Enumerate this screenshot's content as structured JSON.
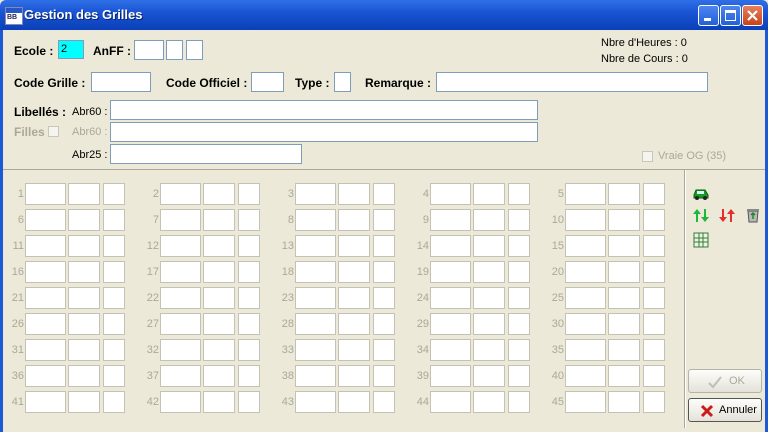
{
  "window": {
    "title": "Gestion des Grilles",
    "app_icon_text": "BB"
  },
  "header": {
    "ecole_label": "Ecole :",
    "ecole_value": "2",
    "anff_label": "AnFF :",
    "anff_values": [
      "",
      "",
      ""
    ],
    "nbre_heures": "Nbre d'Heures : 0",
    "nbre_cours": "Nbre de Cours : 0",
    "code_grille_label": "Code Grille :",
    "code_grille_value": "",
    "code_officiel_label": "Code Officiel :",
    "code_officiel_value": "",
    "type_label": "Type :",
    "type_value": "",
    "remarque_label": "Remarque :",
    "remarque_value": "",
    "libelles_label": "Libellés :",
    "abr60_label": "Abr60 :",
    "abr60_value": "",
    "filles_label": "Filles",
    "abr60_filles_label": "Abr60 :",
    "abr60_filles_value": "",
    "abr25_label": "Abr25 :",
    "abr25_value": "",
    "vraie_og_label": "Vraie OG (35)"
  },
  "grid": {
    "rows": [
      [
        "1",
        "2",
        "3",
        "4",
        "5"
      ],
      [
        "6",
        "7",
        "8",
        "9",
        "10"
      ],
      [
        "11",
        "12",
        "13",
        "14",
        "15"
      ],
      [
        "16",
        "17",
        "18",
        "19",
        "20"
      ],
      [
        "21",
        "22",
        "23",
        "24",
        "25"
      ],
      [
        "26",
        "27",
        "28",
        "29",
        "30"
      ],
      [
        "31",
        "32",
        "33",
        "34",
        "35"
      ],
      [
        "36",
        "37",
        "38",
        "39",
        "40"
      ],
      [
        "41",
        "42",
        "43",
        "44",
        "45"
      ]
    ]
  },
  "toolbar": {
    "icons": [
      "car-icon",
      "sort-up-down-green-icon",
      "sort-up-down-red-icon",
      "recycle-bin-icon",
      "table-icon"
    ]
  },
  "buttons": {
    "ok_label": "OK",
    "annuler_label": "Annuler"
  },
  "colors": {
    "title_bar": "#0a3fb8",
    "window_bg": "#ece9d8",
    "ecole_field": "#00ffff"
  }
}
